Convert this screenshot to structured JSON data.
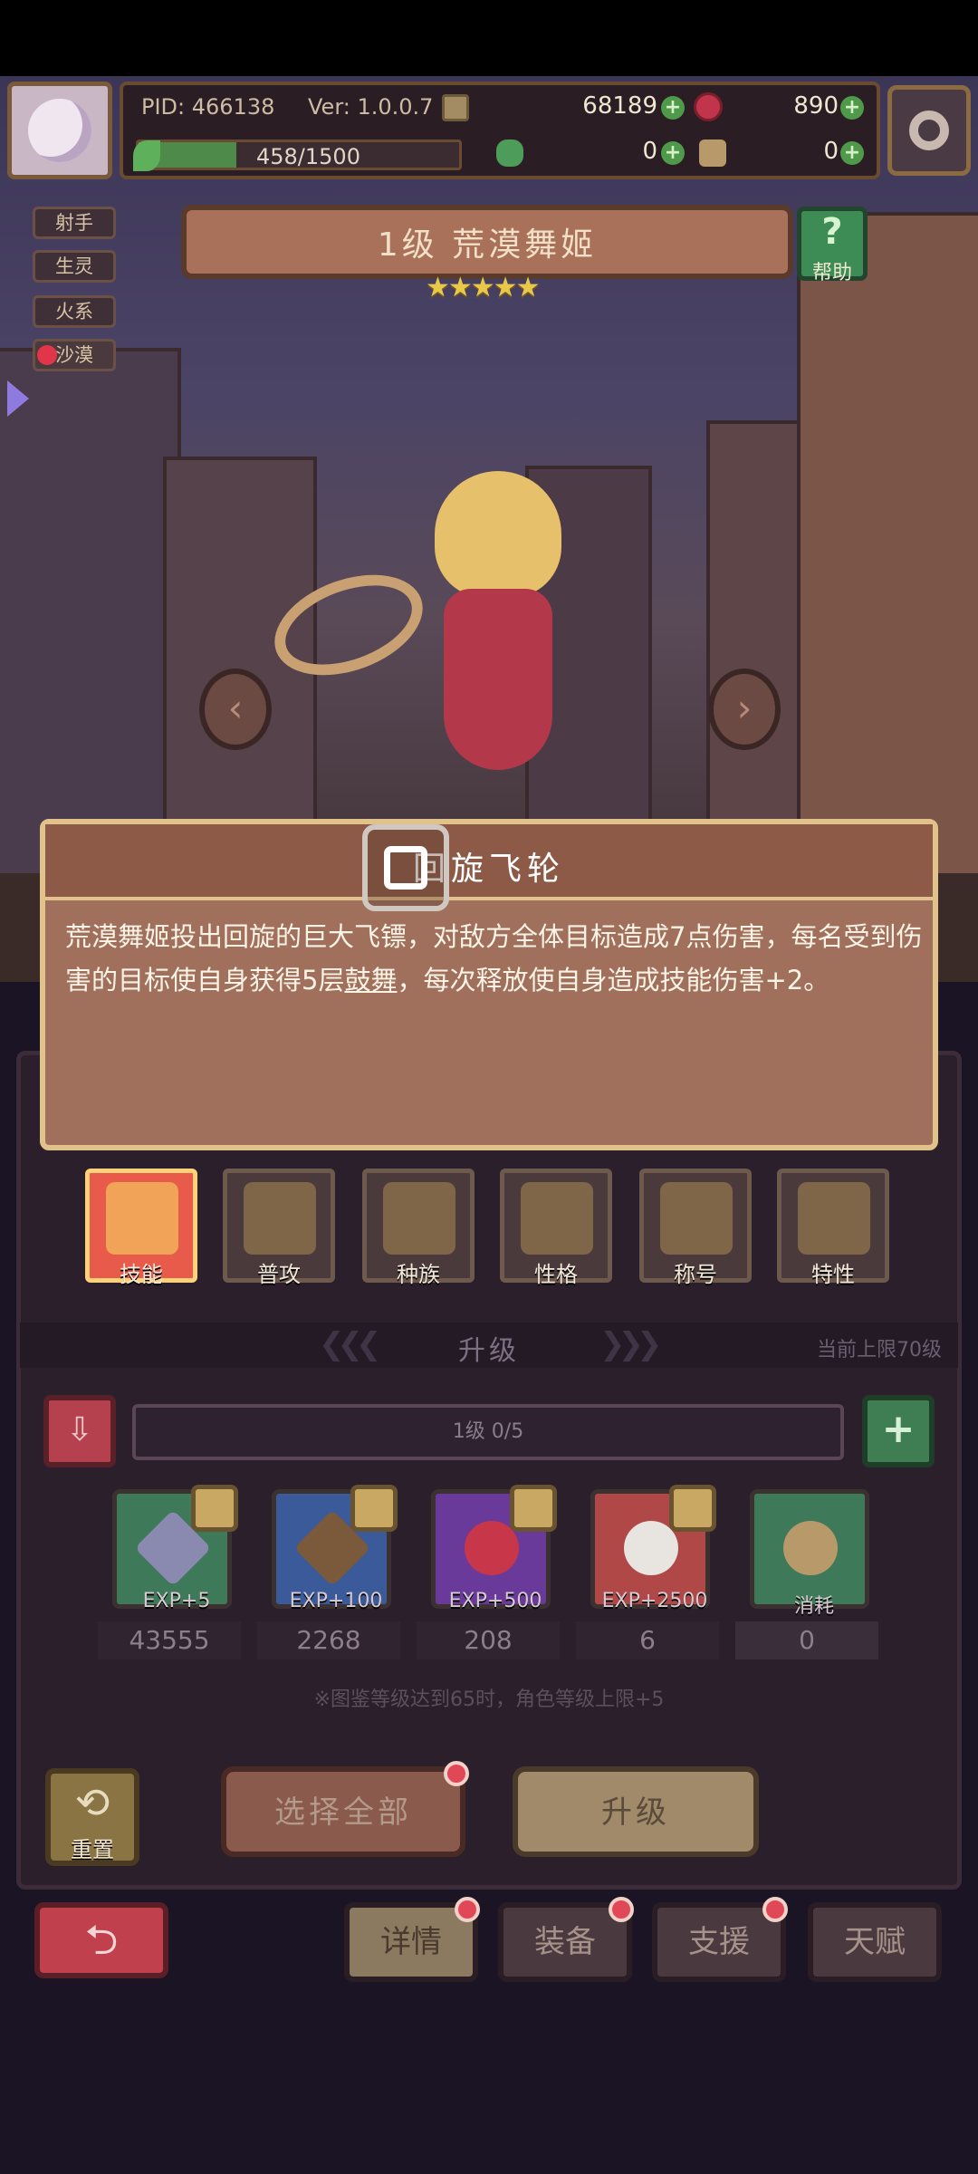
{
  "header": {
    "pid": "PID: 466138",
    "version": "Ver: 1.0.0.7",
    "gold": "68189",
    "gems": "890",
    "exp": "458/1500",
    "exp_fraction": 0.305,
    "clover": "0",
    "hand": "0"
  },
  "side_tags": [
    "射手",
    "生灵",
    "火系",
    "沙漠"
  ],
  "character": {
    "title": "1级  荒漠舞姬",
    "stars": "★★★★★",
    "help_label": "帮助"
  },
  "skill_popup": {
    "name": "回旋飞轮",
    "desc_part1": "荒漠舞姬投出回旋的巨大飞镖，对敌方全体目标造成7点伤害，每名受到伤害的目标使自身获得5层",
    "desc_keyword": "鼓舞",
    "desc_part2": "，每次释放使自身造成技能伤害+2。"
  },
  "tabs": [
    "技能",
    "普攻",
    "种族",
    "性格",
    "称号",
    "特性"
  ],
  "upgrade": {
    "title": "升级",
    "cap": "当前上限70级",
    "level_progress": "1级  0/5"
  },
  "items": [
    {
      "label": "EXP+5",
      "count": "43555",
      "color": "#3e7a5a"
    },
    {
      "label": "EXP+100",
      "count": "2268",
      "color": "#3b5a9a"
    },
    {
      "label": "EXP+500",
      "count": "208",
      "color": "#6a3a9a"
    },
    {
      "label": "EXP+2500",
      "count": "6",
      "color": "#b04848"
    },
    {
      "label": "消耗",
      "count": "0",
      "color": "#3e7a5a"
    }
  ],
  "note": "※图鉴等级达到65时，角色等级上限+5",
  "buttons": {
    "reset": "重置",
    "select_all": "选择全部",
    "upgrade": "升级"
  },
  "nav": [
    "详情",
    "装备",
    "支援",
    "天赋"
  ]
}
